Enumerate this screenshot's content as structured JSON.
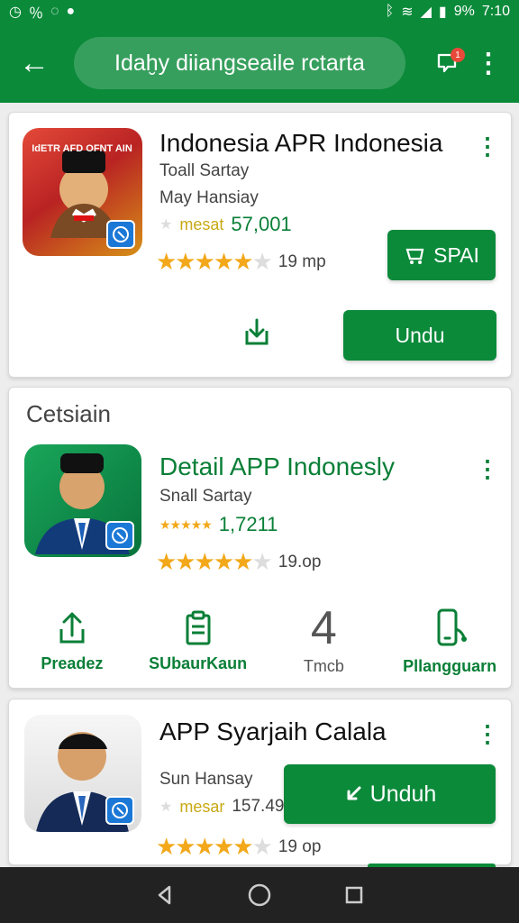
{
  "status": {
    "left_icons": [
      "clock-icon",
      "percent-icon",
      "message-icon",
      "chat-icon"
    ],
    "right_icons": [
      "bluetooth-icon",
      "wifi-icon",
      "signal-icon",
      "battery-icon"
    ],
    "battery_text": "9%",
    "time": "7:10"
  },
  "toolbar": {
    "search_placeholder": "Idaḫy diiangseaile rctarta",
    "notification_count": "1"
  },
  "apps": [
    {
      "title": "Indonesia APR Indonesia",
      "developer": "Toall Sartay",
      "subtitle": "May Hansiay",
      "size_label": "mesat",
      "downloads": "57,001",
      "rating_meta": "19 mp",
      "primary_button": "SPAI",
      "secondary_button": "Undu",
      "icon_text": "IdETR AFD OFNT AIN"
    },
    {
      "section": "Cetsiain",
      "title": "Detail APP Indonesly",
      "developer": "Snall Sartay",
      "rating_count": "1,7211",
      "rating_meta": "19.op",
      "actions": [
        {
          "label": "Preadez",
          "icon": "share-icon"
        },
        {
          "label": "SUbaurKaun",
          "icon": "clipboard-icon"
        },
        {
          "value": "4",
          "label": "Tmcb"
        },
        {
          "label": "Pllangguarn",
          "icon": "phone-icon"
        }
      ]
    },
    {
      "title": "APP Syarjaih Calala",
      "developer": "Sun Hansay",
      "size_label": "mesar",
      "downloads": "157.49",
      "rating_meta": "19 op",
      "button": "Unduh"
    }
  ],
  "colors": {
    "primary": "#0b8a3a",
    "text_green": "#0a7f37",
    "star": "#f2a81a",
    "badge": "#e84a3a"
  }
}
